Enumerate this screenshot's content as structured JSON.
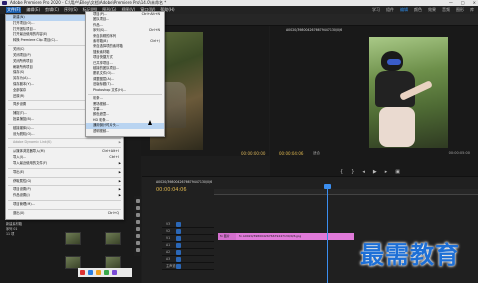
{
  "title": "Adobe Premiere Pro 2020 - C:\\用户\\Elley\\文档\\Adobe\\Premiere Pro\\14.0\\未命名 *",
  "window_controls": {
    "minimize": "—",
    "maximize": "□",
    "close": "×"
  },
  "menubar": [
    "文件(F)",
    "编辑(E)",
    "剪辑(C)",
    "序列(S)",
    "标记(M)",
    "图形(G)",
    "视图(V)",
    "窗口(W)",
    "帮助(H)"
  ],
  "top_tabs": [
    "学习",
    "组件",
    "编辑",
    "颜色",
    "效果",
    "音频",
    "图形",
    "库"
  ],
  "file_menu": [
    {
      "label": "新建(N)",
      "shortcut": "",
      "submenu": true,
      "hl": true
    },
    {
      "label": "打开项目(O)...",
      "shortcut": "Ctrl+O"
    },
    {
      "label": "打开团队项目...",
      "shortcut": ""
    },
    {
      "label": "打开最近使用的内容(E)",
      "shortcut": "",
      "submenu": true
    },
    {
      "label": "转换 Premiere Clip 项目(C)...",
      "shortcut": ""
    },
    {
      "sep": true
    },
    {
      "label": "关闭(C)",
      "shortcut": "Ctrl+W"
    },
    {
      "label": "关闭项目(P)",
      "shortcut": "Ctrl+Shift+W"
    },
    {
      "label": "关闭所有项目",
      "shortcut": ""
    },
    {
      "label": "刷新所有项目",
      "shortcut": ""
    },
    {
      "label": "保存(S)",
      "shortcut": "Ctrl+S"
    },
    {
      "label": "另存为(A)...",
      "shortcut": "Ctrl+Shift+S"
    },
    {
      "label": "保存副本(Y)...",
      "shortcut": "Ctrl+Alt+S"
    },
    {
      "label": "全部保存",
      "shortcut": ""
    },
    {
      "label": "还原(R)",
      "shortcut": ""
    },
    {
      "sep": true
    },
    {
      "label": "同步设置",
      "shortcut": "",
      "submenu": true
    },
    {
      "sep": true
    },
    {
      "label": "捕捉(T)...",
      "shortcut": "F5"
    },
    {
      "label": "批量捕捉(B)...",
      "shortcut": "F6"
    },
    {
      "sep": true
    },
    {
      "label": "链接媒体(L)...",
      "shortcut": ""
    },
    {
      "label": "设为脱机(O)...",
      "shortcut": ""
    },
    {
      "sep": true
    },
    {
      "label": "Adobe Dynamic Link(K)",
      "shortcut": "",
      "submenu": true,
      "dis": true
    },
    {
      "sep": true
    },
    {
      "label": "从媒体浏览器导入(M)",
      "shortcut": "Ctrl+Alt+I"
    },
    {
      "label": "导入(I)...",
      "shortcut": "Ctrl+I"
    },
    {
      "label": "导入最近使用的文件(F)",
      "shortcut": "",
      "submenu": true
    },
    {
      "sep": true
    },
    {
      "label": "导出(E)",
      "shortcut": "",
      "submenu": true
    },
    {
      "sep": true
    },
    {
      "label": "获取属性(G)",
      "shortcut": "",
      "submenu": true
    },
    {
      "sep": true
    },
    {
      "label": "项目设置(P)",
      "shortcut": "",
      "submenu": true
    },
    {
      "label": "作品设置(J)",
      "shortcut": "",
      "submenu": true
    },
    {
      "sep": true
    },
    {
      "label": "项目管理(M)...",
      "shortcut": ""
    },
    {
      "sep": true
    },
    {
      "label": "退出(X)",
      "shortcut": "Ctrl+Q"
    }
  ],
  "new_menu": [
    {
      "label": "项目(P)...",
      "shortcut": "Ctrl+Alt+N"
    },
    {
      "label": "团队项目...",
      "shortcut": ""
    },
    {
      "label": "作品...",
      "shortcut": ""
    },
    {
      "label": "序列(S)...",
      "shortcut": "Ctrl+N"
    },
    {
      "label": "来自剪辑的序列",
      "shortcut": ""
    },
    {
      "label": "素材箱(B)",
      "shortcut": "Ctrl+/"
    },
    {
      "label": "来自选择项的素材箱",
      "shortcut": ""
    },
    {
      "label": "搜索素材箱",
      "shortcut": ""
    },
    {
      "label": "项目快捷方式",
      "shortcut": ""
    },
    {
      "label": "已共享项目...",
      "shortcut": ""
    },
    {
      "label": "链接的团队项目...",
      "shortcut": ""
    },
    {
      "label": "脱机文件(O)...",
      "shortcut": ""
    },
    {
      "label": "调整图层(A)...",
      "shortcut": ""
    },
    {
      "label": "旧版标题(T)...",
      "shortcut": ""
    },
    {
      "label": "Photoshop 文件(H)...",
      "shortcut": ""
    },
    {
      "sep": true
    },
    {
      "label": "彩条...",
      "shortcut": ""
    },
    {
      "label": "黑场视频...",
      "shortcut": ""
    },
    {
      "label": "字幕...",
      "shortcut": ""
    },
    {
      "label": "颜色遮罩...",
      "shortcut": ""
    },
    {
      "label": "HD 彩条...",
      "shortcut": ""
    },
    {
      "label": "通用倒计时片头...",
      "shortcut": "",
      "hl": true
    },
    {
      "label": "透明视频...",
      "shortcut": ""
    }
  ],
  "source_monitor": {
    "timecode": "00:00:00:00",
    "page": "1/2"
  },
  "program_monitor": {
    "tab": "A0020/3980042676679447130/0/6",
    "timecode": "00:00:04:06",
    "fit": "适合",
    "duration": "00:00:05:00"
  },
  "timeline": {
    "tab": "A0020/3980042676679447130/0/6",
    "timecode": "00:00:04:06"
  },
  "tracks": [
    {
      "name": "V3"
    },
    {
      "name": "V2"
    },
    {
      "name": "V1"
    },
    {
      "name": "A1"
    },
    {
      "name": "A2"
    },
    {
      "name": "A3"
    },
    {
      "name": "主声道"
    }
  ],
  "clips": {
    "a": "fx 图片",
    "b": "fx A0020/3980042676679447130/0/6.jpg"
  },
  "project": {
    "items": [
      "A0020/3980042...",
      "A0020/3980042...",
      "新建素材箱",
      "序列 01"
    ],
    "count": "11 项"
  },
  "watermark": "最需教育",
  "colors": {
    "accent": "#2d8ceb",
    "timecode": "#e0b84f",
    "clip": "#e07ad9",
    "watermark": "#1d6fd6"
  }
}
